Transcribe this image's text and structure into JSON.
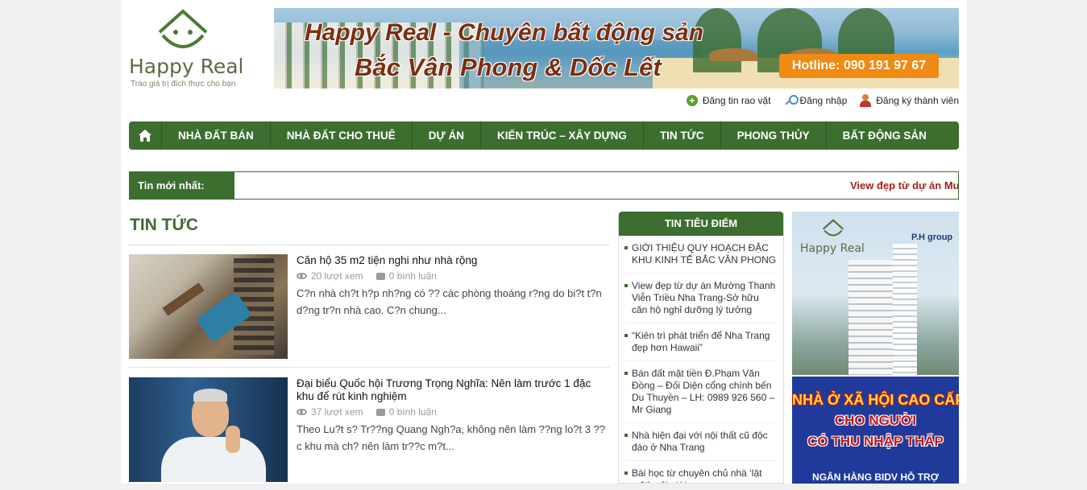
{
  "logo": {
    "name": "Happy Real",
    "tagline": "Trao giá trị đích thực cho bạn"
  },
  "banner": {
    "line1": "Happy Real - Chuyên bất động sản",
    "line2": "Bắc Vân Phong & Dốc Lết",
    "hotline": "Hotline: 090 191 97 67"
  },
  "toplinks": [
    {
      "label": "Đăng tin rao vặt",
      "icon": "plus-circle-icon"
    },
    {
      "label": "Đăng nhập",
      "icon": "key-icon"
    },
    {
      "label": "Đăng ký thành viên",
      "icon": "user-icon"
    }
  ],
  "nav": {
    "home_icon": "home-icon",
    "items": [
      "NHÀ ĐẤT BÁN",
      "NHÀ ĐẤT CHO THUÊ",
      "DỰ ÁN",
      "KIẾN TRÚC – XÂY DỰNG",
      "TIN TỨC",
      "PHONG THỦY",
      "BẤT ĐỘNG SẢN"
    ]
  },
  "ticker": {
    "label": "Tin mới nhất:",
    "text": "View đẹp từ dự án Mu"
  },
  "main": {
    "section_title": "TIN TỨC",
    "posts": [
      {
        "title": "Căn hộ 35 m2 tiện nghi như nhà rộng",
        "views": "20 lượt xem",
        "comments": "0 bình luận",
        "excerpt": "C?n nhà ch?t h?p nh?ng có ?? các phòng thoáng r?ng do bi?t t?n d?ng tr?n nhà cao. C?n chung..."
      },
      {
        "title": "Đại biểu Quốc hội Trương Trọng Nghĩa: Nên làm trước 1 đặc khu để rút kinh nghiệm",
        "views": "37 lượt xem",
        "comments": "0 bình luận",
        "excerpt": "Theo Lu?t s? Tr??ng Quang Ngh?a, không nên làm ??ng lo?t 3 ?? c khu mà ch? nên làm tr??c m?t..."
      }
    ]
  },
  "sidebar": {
    "title": "TIN TIÊU ĐIỂM",
    "items": [
      "GIỚI THIỆU QUY HOẠCH ĐẶC KHU KINH TẾ BẮC VÂN PHONG",
      "View đẹp từ dự án Mường Thanh Viễn Triều Nha Trang-Sở hữu căn hộ nghỉ dưỡng lý tưởng",
      "“Kiên trì phát triển để Nha Trang đẹp hơn Hawaii”",
      "Bán đất mặt tiền Đ.Phạm Văn Đồng – Đối Diện cổng chính bến Du Thuyền – LH: 0989 926 560 – Mr Giang",
      "Nhà hiện đại với nội thất cũ độc đáo ở Nha Trang",
      "Bài học từ chuyên chủ nhà ‘lật mặt’ môi giới"
    ]
  },
  "ads": {
    "ad1_logo": "Happy Real",
    "ad1_partner": "P.H group",
    "ad2_line1": "NHÀ Ở XÃ HỘI CAO CẤP",
    "ad2_line2": "CHO NGƯỜI",
    "ad2_line3": "CÓ THU NHẬP THẤP",
    "ad2_bottom": "NGÂN HÀNG BIDV  HỖ TRỢ"
  },
  "colors": {
    "primary_green": "#3b6e2f",
    "ticker_red": "#a4221d",
    "hotline_orange": "#f08a12"
  }
}
